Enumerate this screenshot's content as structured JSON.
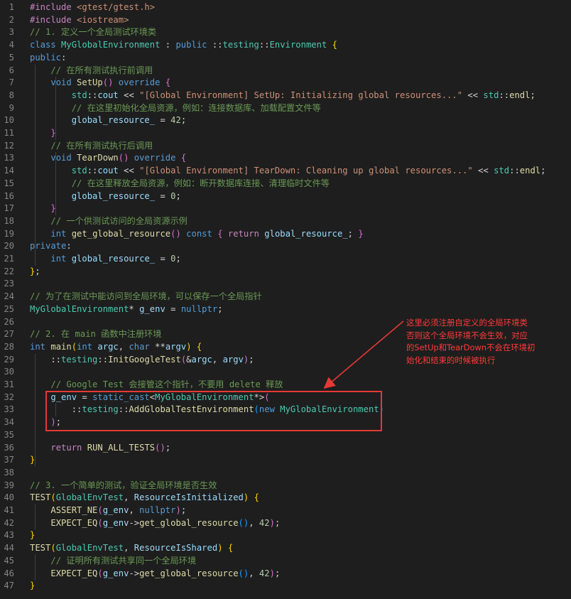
{
  "editor": {
    "lines": [
      {
        "n": "1",
        "tokens": [
          [
            "inc",
            "#include "
          ],
          [
            "str",
            "<gtest/gtest.h>"
          ]
        ]
      },
      {
        "n": "2",
        "tokens": [
          [
            "inc",
            "#include "
          ],
          [
            "str",
            "<iostream>"
          ]
        ]
      },
      {
        "n": "3",
        "tokens": [
          [
            "cmt",
            "// 1. 定义一个全局测试环境类"
          ]
        ]
      },
      {
        "n": "4",
        "tokens": [
          [
            "kw",
            "class "
          ],
          [
            "type",
            "MyGlobalEnvironment"
          ],
          [
            "pl",
            " : "
          ],
          [
            "kw",
            "public "
          ],
          [
            "pl",
            "::"
          ],
          [
            "type",
            "testing"
          ],
          [
            "pl",
            "::"
          ],
          [
            "type",
            "Environment "
          ],
          [
            "br1",
            "{"
          ]
        ]
      },
      {
        "n": "5",
        "tokens": [
          [
            "kw",
            "public"
          ],
          [
            "pl",
            ":"
          ]
        ]
      },
      {
        "n": "6",
        "tokens": [
          [
            "pl",
            "    "
          ],
          [
            "cmt",
            "// 在所有测试执行前调用"
          ]
        ]
      },
      {
        "n": "7",
        "tokens": [
          [
            "pl",
            "    "
          ],
          [
            "kw",
            "void "
          ],
          [
            "fn",
            "SetUp"
          ],
          [
            "br2",
            "()"
          ],
          [
            "pl",
            " "
          ],
          [
            "kw",
            "override "
          ],
          [
            "br2",
            "{"
          ]
        ]
      },
      {
        "n": "8",
        "tokens": [
          [
            "pl",
            "        "
          ],
          [
            "type",
            "std"
          ],
          [
            "pl",
            "::"
          ],
          [
            "var",
            "cout"
          ],
          [
            "pl",
            " << "
          ],
          [
            "str",
            "\"[Global Environment] SetUp: Initializing global resources...\""
          ],
          [
            "pl",
            " << "
          ],
          [
            "type",
            "std"
          ],
          [
            "pl",
            "::"
          ],
          [
            "fn",
            "endl"
          ],
          [
            "pl",
            ";"
          ]
        ]
      },
      {
        "n": "9",
        "tokens": [
          [
            "pl",
            "        "
          ],
          [
            "cmt",
            "// 在这里初始化全局资源，例如：连接数据库、加载配置文件等"
          ]
        ]
      },
      {
        "n": "10",
        "tokens": [
          [
            "pl",
            "        "
          ],
          [
            "var",
            "global_resource_"
          ],
          [
            "pl",
            " = "
          ],
          [
            "num",
            "42"
          ],
          [
            "pl",
            ";"
          ]
        ]
      },
      {
        "n": "11",
        "tokens": [
          [
            "pl",
            "    "
          ],
          [
            "br2",
            "}"
          ]
        ]
      },
      {
        "n": "12",
        "tokens": [
          [
            "pl",
            "    "
          ],
          [
            "cmt",
            "// 在所有测试执行后调用"
          ]
        ]
      },
      {
        "n": "13",
        "tokens": [
          [
            "pl",
            "    "
          ],
          [
            "kw",
            "void "
          ],
          [
            "fn",
            "TearDown"
          ],
          [
            "br2",
            "()"
          ],
          [
            "pl",
            " "
          ],
          [
            "kw",
            "override "
          ],
          [
            "br2",
            "{"
          ]
        ]
      },
      {
        "n": "14",
        "tokens": [
          [
            "pl",
            "        "
          ],
          [
            "type",
            "std"
          ],
          [
            "pl",
            "::"
          ],
          [
            "var",
            "cout"
          ],
          [
            "pl",
            " << "
          ],
          [
            "str",
            "\"[Global Environment] TearDown: Cleaning up global resources...\""
          ],
          [
            "pl",
            " << "
          ],
          [
            "type",
            "std"
          ],
          [
            "pl",
            "::"
          ],
          [
            "fn",
            "endl"
          ],
          [
            "pl",
            ";"
          ]
        ]
      },
      {
        "n": "15",
        "tokens": [
          [
            "pl",
            "        "
          ],
          [
            "cmt",
            "// 在这里释放全局资源，例如：断开数据库连接、清理临时文件等"
          ]
        ]
      },
      {
        "n": "16",
        "tokens": [
          [
            "pl",
            "        "
          ],
          [
            "var",
            "global_resource_"
          ],
          [
            "pl",
            " = "
          ],
          [
            "num",
            "0"
          ],
          [
            "pl",
            ";"
          ]
        ]
      },
      {
        "n": "17",
        "tokens": [
          [
            "pl",
            "    "
          ],
          [
            "br2",
            "}"
          ]
        ]
      },
      {
        "n": "18",
        "tokens": [
          [
            "pl",
            "    "
          ],
          [
            "cmt",
            "// 一个供测试访问的全局资源示例"
          ]
        ]
      },
      {
        "n": "19",
        "tokens": [
          [
            "pl",
            "    "
          ],
          [
            "kw",
            "int "
          ],
          [
            "fn",
            "get_global_resource"
          ],
          [
            "br2",
            "()"
          ],
          [
            "pl",
            " "
          ],
          [
            "kw",
            "const "
          ],
          [
            "br2",
            "{"
          ],
          [
            "pl",
            " "
          ],
          [
            "kw2",
            "return "
          ],
          [
            "var",
            "global_resource_"
          ],
          [
            "pl",
            "; "
          ],
          [
            "br2",
            "}"
          ]
        ]
      },
      {
        "n": "20",
        "tokens": [
          [
            "kw",
            "private"
          ],
          [
            "pl",
            ":"
          ]
        ]
      },
      {
        "n": "21",
        "tokens": [
          [
            "pl",
            "    "
          ],
          [
            "kw",
            "int "
          ],
          [
            "var",
            "global_resource_"
          ],
          [
            "pl",
            " = "
          ],
          [
            "num",
            "0"
          ],
          [
            "pl",
            ";"
          ]
        ]
      },
      {
        "n": "22",
        "tokens": [
          [
            "br1",
            "}"
          ],
          [
            "pl",
            ";"
          ]
        ]
      },
      {
        "n": "23",
        "tokens": []
      },
      {
        "n": "24",
        "tokens": [
          [
            "cmt",
            "// 为了在测试中能访问到全局环境，可以保存一个全局指针"
          ]
        ]
      },
      {
        "n": "25",
        "tokens": [
          [
            "type",
            "MyGlobalEnvironment"
          ],
          [
            "pl",
            "* "
          ],
          [
            "var",
            "g_env"
          ],
          [
            "pl",
            " = "
          ],
          [
            "kw",
            "nullptr"
          ],
          [
            "pl",
            ";"
          ]
        ]
      },
      {
        "n": "26",
        "tokens": []
      },
      {
        "n": "27",
        "tokens": [
          [
            "cmt",
            "// 2. 在 main 函数中注册环境"
          ]
        ]
      },
      {
        "n": "28",
        "tokens": [
          [
            "kw",
            "int "
          ],
          [
            "fn",
            "main"
          ],
          [
            "br1",
            "("
          ],
          [
            "kw",
            "int "
          ],
          [
            "var",
            "argc"
          ],
          [
            "pl",
            ", "
          ],
          [
            "kw",
            "char "
          ],
          [
            "pl",
            "**"
          ],
          [
            "var",
            "argv"
          ],
          [
            "br1",
            ")"
          ],
          [
            "pl",
            " "
          ],
          [
            "br1",
            "{"
          ]
        ]
      },
      {
        "n": "29",
        "tokens": [
          [
            "pl",
            "    ::"
          ],
          [
            "type",
            "testing"
          ],
          [
            "pl",
            "::"
          ],
          [
            "fn",
            "InitGoogleTest"
          ],
          [
            "br2",
            "("
          ],
          [
            "pl",
            "&"
          ],
          [
            "var",
            "argc"
          ],
          [
            "pl",
            ", "
          ],
          [
            "var",
            "argv"
          ],
          [
            "br2",
            ")"
          ],
          [
            "pl",
            ";"
          ]
        ]
      },
      {
        "n": "30",
        "tokens": []
      },
      {
        "n": "31",
        "tokens": [
          [
            "pl",
            "    "
          ],
          [
            "cmt",
            "// Google Test 会接管这个指针，不要用 delete 释放"
          ]
        ]
      },
      {
        "n": "32",
        "tokens": [
          [
            "pl",
            "    "
          ],
          [
            "var",
            "g_env"
          ],
          [
            "pl",
            " = "
          ],
          [
            "kw",
            "static_cast"
          ],
          [
            "pl",
            "<"
          ],
          [
            "type",
            "MyGlobalEnvironment"
          ],
          [
            "pl",
            "*>"
          ],
          [
            "br2",
            "("
          ]
        ]
      },
      {
        "n": "33",
        "tokens": [
          [
            "pl",
            "        ::"
          ],
          [
            "type",
            "testing"
          ],
          [
            "pl",
            "::"
          ],
          [
            "fn",
            "AddGlobalTestEnvironment"
          ],
          [
            "br3",
            "("
          ],
          [
            "kw",
            "new "
          ],
          [
            "type",
            "MyGlobalEnvironment"
          ],
          [
            "br3",
            ")"
          ]
        ]
      },
      {
        "n": "34",
        "tokens": [
          [
            "pl",
            "    "
          ],
          [
            "br2",
            ")"
          ],
          [
            "pl",
            ";"
          ]
        ]
      },
      {
        "n": "35",
        "tokens": []
      },
      {
        "n": "36",
        "tokens": [
          [
            "pl",
            "    "
          ],
          [
            "kw2",
            "return "
          ],
          [
            "fn",
            "RUN_ALL_TESTS"
          ],
          [
            "br2",
            "()"
          ],
          [
            "pl",
            ";"
          ]
        ]
      },
      {
        "n": "37",
        "tokens": [
          [
            "br1",
            "}"
          ]
        ]
      },
      {
        "n": "38",
        "tokens": []
      },
      {
        "n": "39",
        "tokens": [
          [
            "cmt",
            "// 3. 一个简单的测试，验证全局环境是否生效"
          ]
        ]
      },
      {
        "n": "40",
        "tokens": [
          [
            "fn",
            "TEST"
          ],
          [
            "br1",
            "("
          ],
          [
            "type",
            "GlobalEnvTest"
          ],
          [
            "pl",
            ", "
          ],
          [
            "var",
            "ResourceIsInitialized"
          ],
          [
            "br1",
            ")"
          ],
          [
            "pl",
            " "
          ],
          [
            "br1",
            "{"
          ]
        ]
      },
      {
        "n": "41",
        "tokens": [
          [
            "pl",
            "    "
          ],
          [
            "fn",
            "ASSERT_NE"
          ],
          [
            "br2",
            "("
          ],
          [
            "var",
            "g_env"
          ],
          [
            "pl",
            ", "
          ],
          [
            "kw",
            "nullptr"
          ],
          [
            "br2",
            ")"
          ],
          [
            "pl",
            ";"
          ]
        ]
      },
      {
        "n": "42",
        "tokens": [
          [
            "pl",
            "    "
          ],
          [
            "fn",
            "EXPECT_EQ"
          ],
          [
            "br2",
            "("
          ],
          [
            "var",
            "g_env"
          ],
          [
            "pl",
            "->"
          ],
          [
            "fn",
            "get_global_resource"
          ],
          [
            "br3",
            "()"
          ],
          [
            "pl",
            ", "
          ],
          [
            "num",
            "42"
          ],
          [
            "br2",
            ")"
          ],
          [
            "pl",
            ";"
          ]
        ]
      },
      {
        "n": "43",
        "tokens": [
          [
            "br1",
            "}"
          ]
        ]
      },
      {
        "n": "44",
        "tokens": [
          [
            "fn",
            "TEST"
          ],
          [
            "br1",
            "("
          ],
          [
            "type",
            "GlobalEnvTest"
          ],
          [
            "pl",
            ", "
          ],
          [
            "var",
            "ResourceIsShared"
          ],
          [
            "br1",
            ")"
          ],
          [
            "pl",
            " "
          ],
          [
            "br1",
            "{"
          ]
        ]
      },
      {
        "n": "45",
        "tokens": [
          [
            "pl",
            "    "
          ],
          [
            "cmt",
            "// 证明所有测试共享同一个全局环境"
          ]
        ]
      },
      {
        "n": "46",
        "tokens": [
          [
            "pl",
            "    "
          ],
          [
            "fn",
            "EXPECT_EQ"
          ],
          [
            "br2",
            "("
          ],
          [
            "var",
            "g_env"
          ],
          [
            "pl",
            "->"
          ],
          [
            "fn",
            "get_global_resource"
          ],
          [
            "br3",
            "()"
          ],
          [
            "pl",
            ", "
          ],
          [
            "num",
            "42"
          ],
          [
            "br2",
            ")"
          ],
          [
            "pl",
            ";"
          ]
        ]
      },
      {
        "n": "47",
        "tokens": [
          [
            "br1",
            "}"
          ]
        ]
      }
    ]
  },
  "annotation": {
    "lines": [
      "这里必须注册自定义的全局环境类",
      "否则这个全局环境不会生效，对应",
      "的SetUp和TearDown不会在环境初",
      "始化和结束的时候被执行"
    ]
  },
  "colors": {
    "background": "#1e1e1e",
    "annotation": "#ff3b3b",
    "highlight_box": "#e53935"
  }
}
